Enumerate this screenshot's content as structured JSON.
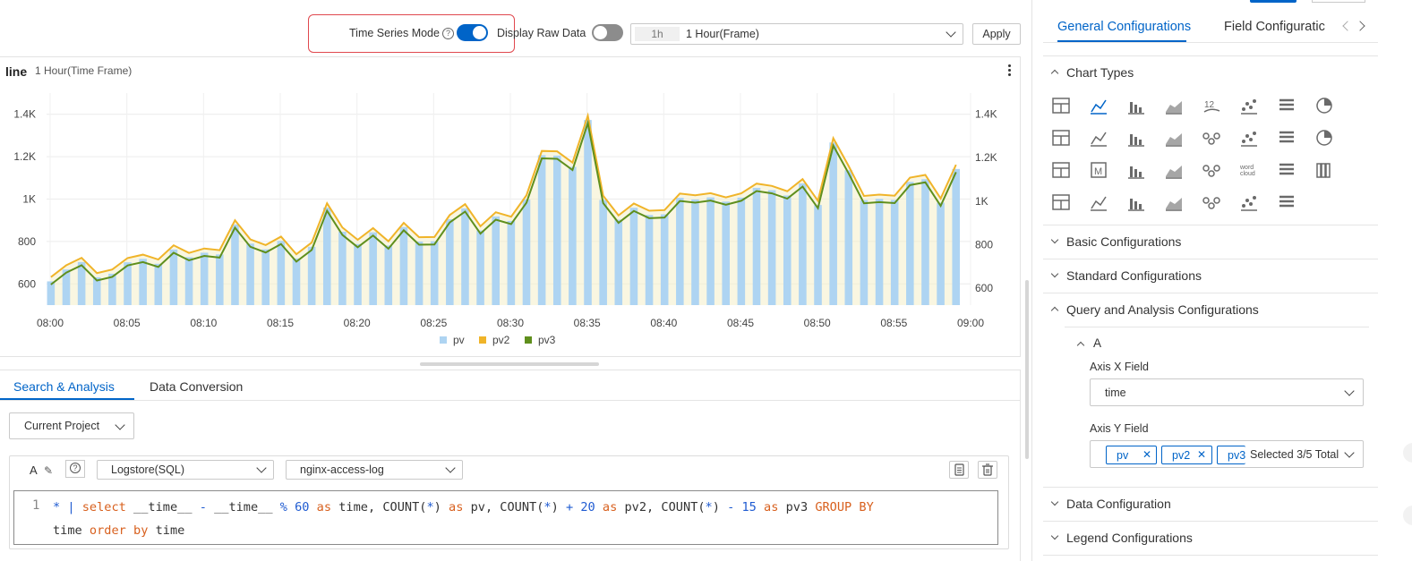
{
  "toolbar": {
    "time_series_mode_label": "Time Series Mode",
    "time_series_mode_on": true,
    "display_raw_data_label": "Display Raw Data",
    "display_raw_data_on": false,
    "time_chip": "1h",
    "time_range": "1 Hour(Frame)",
    "apply_label": "Apply"
  },
  "chart_panel": {
    "title": "line",
    "subtitle": "1 Hour(Time Frame)"
  },
  "chart_data": {
    "type": "bar",
    "x_ticks": [
      "08:00",
      "08:05",
      "08:10",
      "08:15",
      "08:20",
      "08:25",
      "08:30",
      "08:35",
      "08:40",
      "08:45",
      "08:50",
      "08:55",
      "09:00"
    ],
    "x_range_minutes": [
      0,
      60
    ],
    "y_left_ticks": [
      "600",
      "800",
      "1K",
      "1.2K",
      "1.4K"
    ],
    "y_right_ticks": [
      "600",
      "800",
      "1K",
      "1.2K",
      "1.4K"
    ],
    "y_left_range": [
      500,
      1500
    ],
    "y_right_range": [
      500,
      1500
    ],
    "legend_position": "bottom",
    "colors": {
      "pv": "#aed4f2",
      "pv2": "#f0b429",
      "pv3": "#5f8f1d"
    },
    "series": [
      {
        "name": "pv",
        "kind": "bar",
        "values": [
          612,
          668,
          703,
          631,
          648,
          702,
          718,
          695,
          762,
          726,
          747,
          739,
          880,
          790,
          763,
          803,
          720,
          775,
          960,
          846,
          788,
          843,
          781,
          868,
          800,
          801,
          905,
          956,
          852,
          918,
          897,
          998,
          1207,
          1205,
          1152,
          1373,
          996,
          903,
          959,
          925,
          928,
          1006,
          998,
          1008,
          988,
          1007,
          1053,
          1042,
          1017,
          1074,
          972,
          1267,
          1136,
          995,
          1001,
          996,
          1081,
          1094,
          983,
          1142
        ]
      },
      {
        "name": "pv2",
        "kind": "line",
        "values": [
          632,
          688,
          723,
          651,
          668,
          722,
          738,
          715,
          782,
          746,
          767,
          759,
          900,
          810,
          783,
          823,
          740,
          795,
          980,
          866,
          808,
          863,
          801,
          888,
          820,
          821,
          925,
          976,
          872,
          938,
          917,
          1018,
          1227,
          1225,
          1172,
          1393,
          1016,
          923,
          979,
          945,
          948,
          1026,
          1018,
          1028,
          1008,
          1027,
          1073,
          1062,
          1037,
          1094,
          992,
          1287,
          1156,
          1015,
          1021,
          1016,
          1101,
          1114,
          1003,
          1162
        ]
      },
      {
        "name": "pv3",
        "kind": "line",
        "values": [
          597,
          653,
          688,
          616,
          633,
          687,
          703,
          680,
          747,
          711,
          732,
          724,
          865,
          775,
          748,
          788,
          705,
          760,
          945,
          831,
          773,
          828,
          766,
          853,
          785,
          786,
          890,
          941,
          837,
          903,
          882,
          983,
          1192,
          1190,
          1137,
          1358,
          981,
          888,
          944,
          910,
          913,
          991,
          983,
          993,
          973,
          992,
          1038,
          1027,
          1002,
          1059,
          957,
          1252,
          1121,
          980,
          986,
          981,
          1066,
          1079,
          968,
          1127
        ]
      }
    ]
  },
  "query_panel": {
    "tabs": [
      "Search & Analysis",
      "Data Conversion"
    ],
    "project_select": "Current Project",
    "store_type": "Logstore(SQL)",
    "logstore": "nginx-access-log",
    "editor_a": "A",
    "line_number": "1",
    "code": {
      "l1_star": "* ",
      "l1_pipe": "| ",
      "l1_select": "select",
      "l1_a": " __time__ ",
      "l1_minus1": "-",
      "l1_b": " __time__ ",
      "l1_pct": "%",
      "l1_sp1": " ",
      "l1_60": "60",
      "l1_sp2": " ",
      "l1_as1": "as",
      "l1_c": " time, COUNT(",
      "l1_star2": "*",
      "l1_d": ") ",
      "l1_as2": "as",
      "l1_e": " pv, COUNT(",
      "l1_star3": "*",
      "l1_f": ") ",
      "l1_plus": "+",
      "l1_sp3": " ",
      "l1_20": "20",
      "l1_sp4": " ",
      "l1_as3": "as",
      "l1_g": " pv2, COUNT(",
      "l1_star4": "*",
      "l1_h": ") ",
      "l1_minus2": "-",
      "l1_sp5": " ",
      "l1_15": "15",
      "l1_sp6": " ",
      "l1_as4": "as",
      "l1_i": " pv3 ",
      "l1_groupby": "GROUP BY",
      "l2_time": "time ",
      "l2_orderby": "order by",
      "l2_time2": " time"
    }
  },
  "right_panel": {
    "tabs": [
      "General Configurations",
      "Field Configuratic"
    ],
    "sections": {
      "chart_types": "Chart Types",
      "basic": "Basic Configurations",
      "standard": "Standard Configurations",
      "query_analysis": "Query and Analysis Configurations",
      "data_config": "Data Configuration",
      "legend": "Legend Configurations"
    },
    "query_a": "A",
    "axis_x_label": "Axis X Field",
    "axis_x_value": "time",
    "axis_y_label": "Axis Y Field",
    "axis_y_tags": [
      "pv",
      "pv2",
      "pv3"
    ],
    "axis_y_selected": "Selected 3/5 Total",
    "icon_word_cloud": "word cloud",
    "icon_12": "12",
    "icon_m": "M"
  }
}
